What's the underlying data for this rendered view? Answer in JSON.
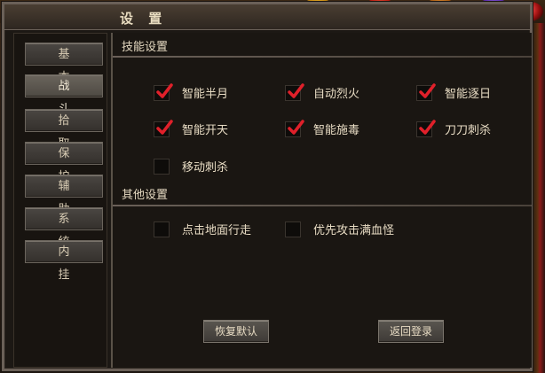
{
  "dialog": {
    "title": "设 置"
  },
  "sidebar": {
    "items": [
      {
        "label": "基 本",
        "active": false
      },
      {
        "label": "战 斗",
        "active": true
      },
      {
        "label": "拾 取",
        "active": false
      },
      {
        "label": "保 护",
        "active": false
      },
      {
        "label": "辅 助",
        "active": false
      },
      {
        "label": "系 统",
        "active": false
      },
      {
        "label": "内 挂",
        "active": false
      }
    ]
  },
  "skills": {
    "title": "技能设置",
    "options": [
      {
        "label": "智能半月",
        "checked": true
      },
      {
        "label": "自动烈火",
        "checked": true
      },
      {
        "label": "智能逐日",
        "checked": true
      },
      {
        "label": "智能开天",
        "checked": true
      },
      {
        "label": "智能施毒",
        "checked": true
      },
      {
        "label": "刀刀刺杀",
        "checked": true
      },
      {
        "label": "移动刺杀",
        "checked": false
      }
    ]
  },
  "other": {
    "title": "其他设置",
    "options": [
      {
        "label": "点击地面行走",
        "checked": false
      },
      {
        "label": "优先攻击满血怪",
        "checked": false
      }
    ]
  },
  "buttons": {
    "restore_default": "恢复默认",
    "return_login": "返回登录"
  },
  "colors": {
    "checkmark": "#e0202a",
    "text": "#e8dcc4",
    "frame": "#6a6058"
  }
}
